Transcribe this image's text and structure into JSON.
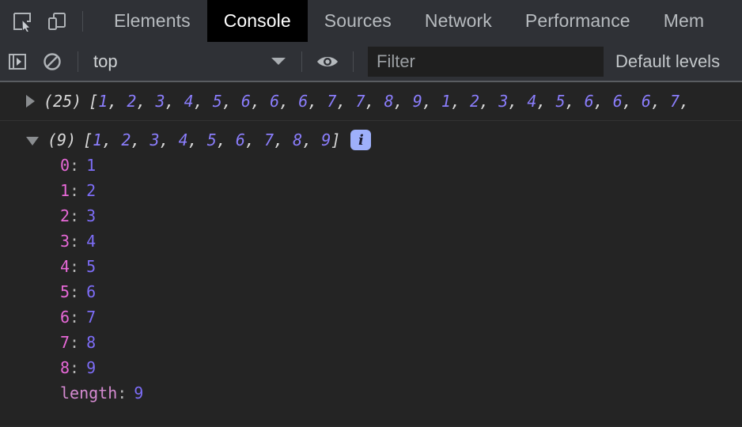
{
  "tabbar": {
    "icons": [
      {
        "name": "inspect-element-icon",
        "label": "Inspect element"
      },
      {
        "name": "device-toolbar-icon",
        "label": "Toggle device toolbar"
      }
    ],
    "tabs": [
      {
        "label": "Elements",
        "active": false
      },
      {
        "label": "Console",
        "active": true
      },
      {
        "label": "Sources",
        "active": false
      },
      {
        "label": "Network",
        "active": false
      },
      {
        "label": "Performance",
        "active": false
      },
      {
        "label": "Mem",
        "active": false
      }
    ]
  },
  "controlbar": {
    "sidebar_toggle_icon": "console-sidebar-icon",
    "clear_console_icon": "clear-console-icon",
    "context": {
      "selected": "top",
      "caret_icon": "chevron-down-icon"
    },
    "eye_icon": "eye-icon",
    "filter": {
      "value": "",
      "placeholder": "Filter"
    },
    "levels": {
      "label": "Default levels"
    }
  },
  "console": {
    "rows": [
      {
        "expanded": false,
        "disclosure_icon": "triangle-right-icon",
        "count_label": "(25)",
        "open_bracket": "[",
        "values": [
          1,
          2,
          3,
          4,
          5,
          6,
          6,
          6,
          7,
          7,
          8,
          9,
          1,
          2,
          3,
          4,
          5,
          6,
          6,
          6,
          7
        ],
        "separator": ", ",
        "truncated": true,
        "close_bracket": "",
        "badge": null
      },
      {
        "expanded": true,
        "disclosure_icon": "triangle-down-icon",
        "count_label": "(9)",
        "open_bracket": "[",
        "values": [
          1,
          2,
          3,
          4,
          5,
          6,
          7,
          8,
          9
        ],
        "separator": ", ",
        "truncated": false,
        "close_bracket": "]",
        "badge": "info-badge",
        "badge_glyph": "i",
        "properties": [
          {
            "key": "0",
            "value": "1",
            "kind": "index"
          },
          {
            "key": "1",
            "value": "2",
            "kind": "index"
          },
          {
            "key": "2",
            "value": "3",
            "kind": "index"
          },
          {
            "key": "3",
            "value": "4",
            "kind": "index"
          },
          {
            "key": "4",
            "value": "5",
            "kind": "index"
          },
          {
            "key": "5",
            "value": "6",
            "kind": "index"
          },
          {
            "key": "6",
            "value": "7",
            "kind": "index"
          },
          {
            "key": "7",
            "value": "8",
            "kind": "index"
          },
          {
            "key": "8",
            "value": "9",
            "kind": "index"
          },
          {
            "key": "length",
            "value": "9",
            "kind": "length"
          }
        ]
      }
    ]
  },
  "colors": {
    "background": "#242424",
    "toolbar": "#2f3136",
    "active_tab": "#000000",
    "number": "#8a7dfb",
    "index_key": "#e869d8",
    "length_key": "#d48ad0",
    "badge": "#9eb0fb"
  }
}
